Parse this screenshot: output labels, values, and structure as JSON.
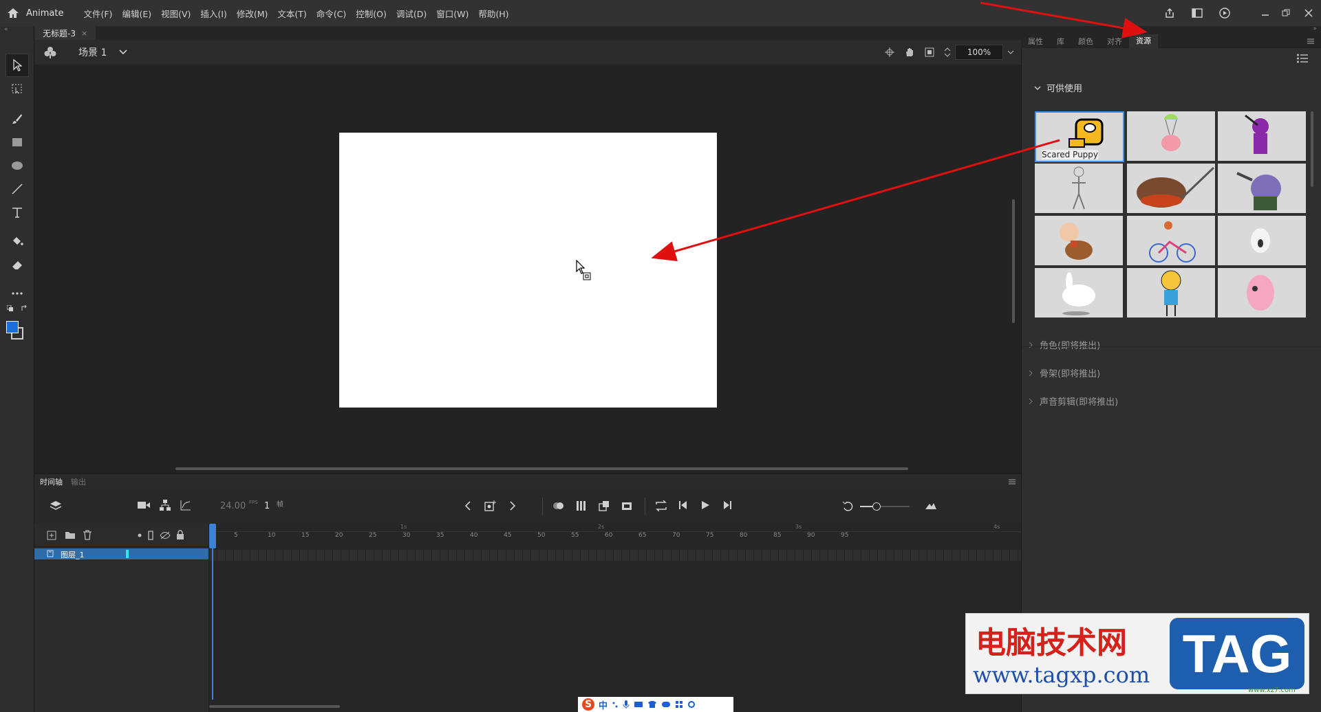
{
  "app": {
    "name": "Animate"
  },
  "menu": [
    "文件(F)",
    "编辑(E)",
    "视图(V)",
    "插入(I)",
    "修改(M)",
    "文本(T)",
    "命令(C)",
    "控制(O)",
    "调试(D)",
    "窗口(W)",
    "帮助(H)"
  ],
  "document": {
    "tab": "无标题-3",
    "scene": "场景 1",
    "zoom": "100%"
  },
  "timeline": {
    "tabs": [
      "时间轴",
      "输出"
    ],
    "fps": "24.00",
    "fps_unit": "FPS",
    "current_frame": "1",
    "frame_unit": "帧",
    "frame_numbers": [
      "5",
      "10",
      "15",
      "20",
      "25",
      "30",
      "35",
      "40",
      "45",
      "50",
      "55",
      "60",
      "65",
      "70",
      "75",
      "80",
      "85",
      "90",
      "95"
    ],
    "seconds": [
      "1s",
      "2s",
      "3s",
      "4s"
    ],
    "layer_name": "图层_1"
  },
  "right_panel": {
    "tabs": [
      "属性",
      "库",
      "颜色",
      "对齐",
      "资源"
    ],
    "active_tab": "资源",
    "available_title": "可供使用",
    "selected_asset_label": "Scared Puppy",
    "sections": [
      "角色(即将推出)",
      "骨架(即将推出)",
      "声音剪辑(即将推出)"
    ]
  },
  "watermark": {
    "title": "电脑技术网",
    "url": "www.tagxp.com",
    "tag": "TAG",
    "small": "www.xz7.com"
  },
  "taskbar": {
    "ime": "中"
  },
  "colors": {
    "accent": "#4a90e2",
    "selection": "#2f6da8",
    "arrow": "#e01010"
  }
}
